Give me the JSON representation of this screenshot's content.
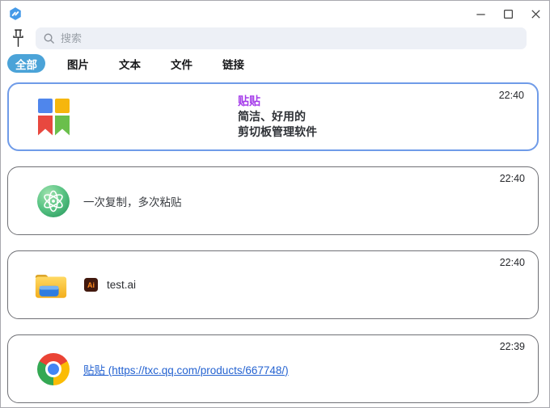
{
  "search": {
    "placeholder": "搜索"
  },
  "tabs": {
    "items": [
      {
        "label": "全部",
        "active": true
      },
      {
        "label": "图片",
        "active": false
      },
      {
        "label": "文本",
        "active": false
      },
      {
        "label": "文件",
        "active": false
      },
      {
        "label": "链接",
        "active": false
      }
    ]
  },
  "cards": [
    {
      "type": "image",
      "time": "22:40",
      "title": "贴贴",
      "line1": "简洁、好用的",
      "line2": "剪切板管理软件",
      "selected": true
    },
    {
      "type": "text",
      "time": "22:40",
      "text": "一次复制，多次粘贴"
    },
    {
      "type": "file",
      "time": "22:40",
      "filename": "test.ai",
      "badge": "Ai"
    },
    {
      "type": "link",
      "time": "22:39",
      "link": "贴贴 (https://txc.qq.com/products/667748/)"
    }
  ],
  "colors": {
    "accent_tab": "#4ba3d8",
    "selected_border": "#6f9be8",
    "card_border": "#6f7075",
    "link": "#2563d1",
    "title_purple": "#a43bea",
    "search_bg": "#edf0f6"
  }
}
